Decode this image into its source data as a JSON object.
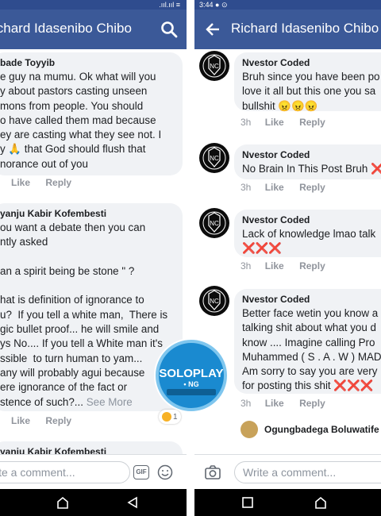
{
  "left": {
    "header": {
      "title": "ichard Idasenibo Chibo"
    },
    "comments": [
      {
        "author": "bade Toyyib",
        "text": "e guy na mumu. Ok what will you\ny about pastors casting unseen\nmons from people. You should\no have called them mad because\ney are casting what they see not. I\ny 🙏 that God should flush that\nnorance out of you",
        "actions": {
          "like": "Like",
          "reply": "Reply"
        }
      },
      {
        "author": "yanju Kabir Kofembesti",
        "text": "ou want a debate then you can\nntly asked\n\nan a spirit being be stone \" ?\n\nhat is definition of ignorance to\nu?  If you tell a white man,  There is\ngic bullet proof... he will smile and\nys No.... If you tell a White man it's\nssible  to turn human to yam...\nany will probably agui because\nere ignorance of the fact or\nstence of such?...",
        "see_more": " See More",
        "reaction_count": "1",
        "actions": {
          "like": "Like",
          "reply": "Reply"
        }
      }
    ],
    "next_author": "yanju Kabir Kofembesti",
    "composer": {
      "placeholder": "ite a comment...",
      "gif": "GIF"
    }
  },
  "right": {
    "header": {
      "title": "Richard Idasenibo Chibo"
    },
    "comments": [
      {
        "author": "Nvestor Coded",
        "text": "Bruh since you have been po\nlove it all but this one you sa\nbullshit 😠😠😠",
        "time": "3h",
        "actions": {
          "like": "Like",
          "reply": "Reply"
        }
      },
      {
        "author": "Nvestor Coded",
        "text": "No Brain In This Post Bruh ❌",
        "time": "3h",
        "actions": {
          "like": "Like",
          "reply": "Reply"
        }
      },
      {
        "author": "Nvestor Coded",
        "text": "Lack of knowledge lmao talk\n❌❌❌",
        "time": "3h",
        "actions": {
          "like": "Like",
          "reply": "Reply"
        }
      },
      {
        "author": "Nvestor Coded",
        "text": "Better face wetin you know a\ntalking shit about what you d\nknow .... Imagine calling Pro\nMuhammed ( S . A . W ) MAD\nAm sorry to say you are very\nfor posting this shit ❌❌❌",
        "time": "3h",
        "actions": {
          "like": "Like",
          "reply": "Reply"
        }
      }
    ],
    "reply_preview_author": "Ogungbadega Boluwatife M",
    "composer": {
      "placeholder": "Write a comment..."
    }
  },
  "status": {
    "left": ".ııl.ııl ≡",
    "right": "3:44 ● ⊙"
  },
  "watermark": {
    "line1": "SOLOPLAY",
    "line2": "• NG"
  },
  "colors": {
    "brand": "#3b5998",
    "bubble": "#f0f2f5",
    "muted": "#90949c",
    "x_red": "#e02020"
  }
}
